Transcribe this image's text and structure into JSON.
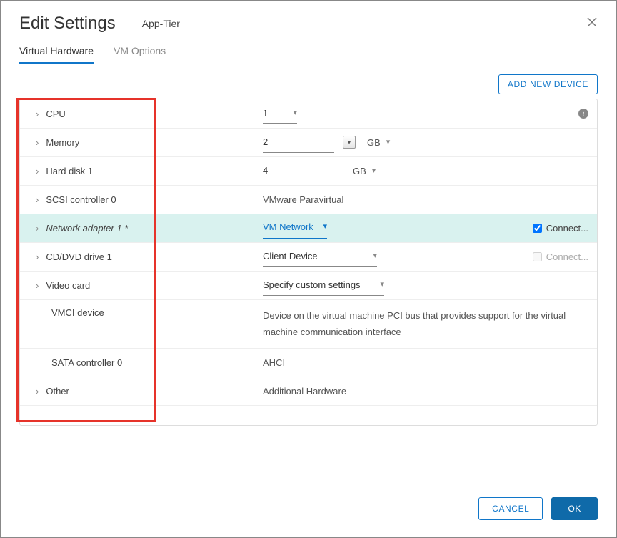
{
  "header": {
    "title": "Edit Settings",
    "subtitle": "App-Tier"
  },
  "tabs": {
    "hardware": "Virtual Hardware",
    "options": "VM Options"
  },
  "toolbar": {
    "add_device": "ADD NEW DEVICE"
  },
  "rows": {
    "cpu": {
      "label": "CPU",
      "value": "1"
    },
    "memory": {
      "label": "Memory",
      "value": "2",
      "unit": "GB"
    },
    "hard_disk": {
      "label": "Hard disk 1",
      "value": "4",
      "unit": "GB"
    },
    "scsi": {
      "label": "SCSI controller 0",
      "value": "VMware Paravirtual"
    },
    "net": {
      "label": "Network adapter 1 *",
      "value": "VM Network",
      "connect": "Connect..."
    },
    "cd": {
      "label": "CD/DVD drive 1",
      "value": "Client Device",
      "connect": "Connect..."
    },
    "video": {
      "label": "Video card",
      "value": "Specify custom settings"
    },
    "vmci": {
      "label": "VMCI device",
      "value": "Device on the virtual machine PCI bus that provides support for the virtual machine communication interface"
    },
    "sata": {
      "label": "SATA controller 0",
      "value": "AHCI"
    },
    "other": {
      "label": "Other",
      "value": "Additional Hardware"
    }
  },
  "footer": {
    "cancel": "CANCEL",
    "ok": "OK"
  }
}
